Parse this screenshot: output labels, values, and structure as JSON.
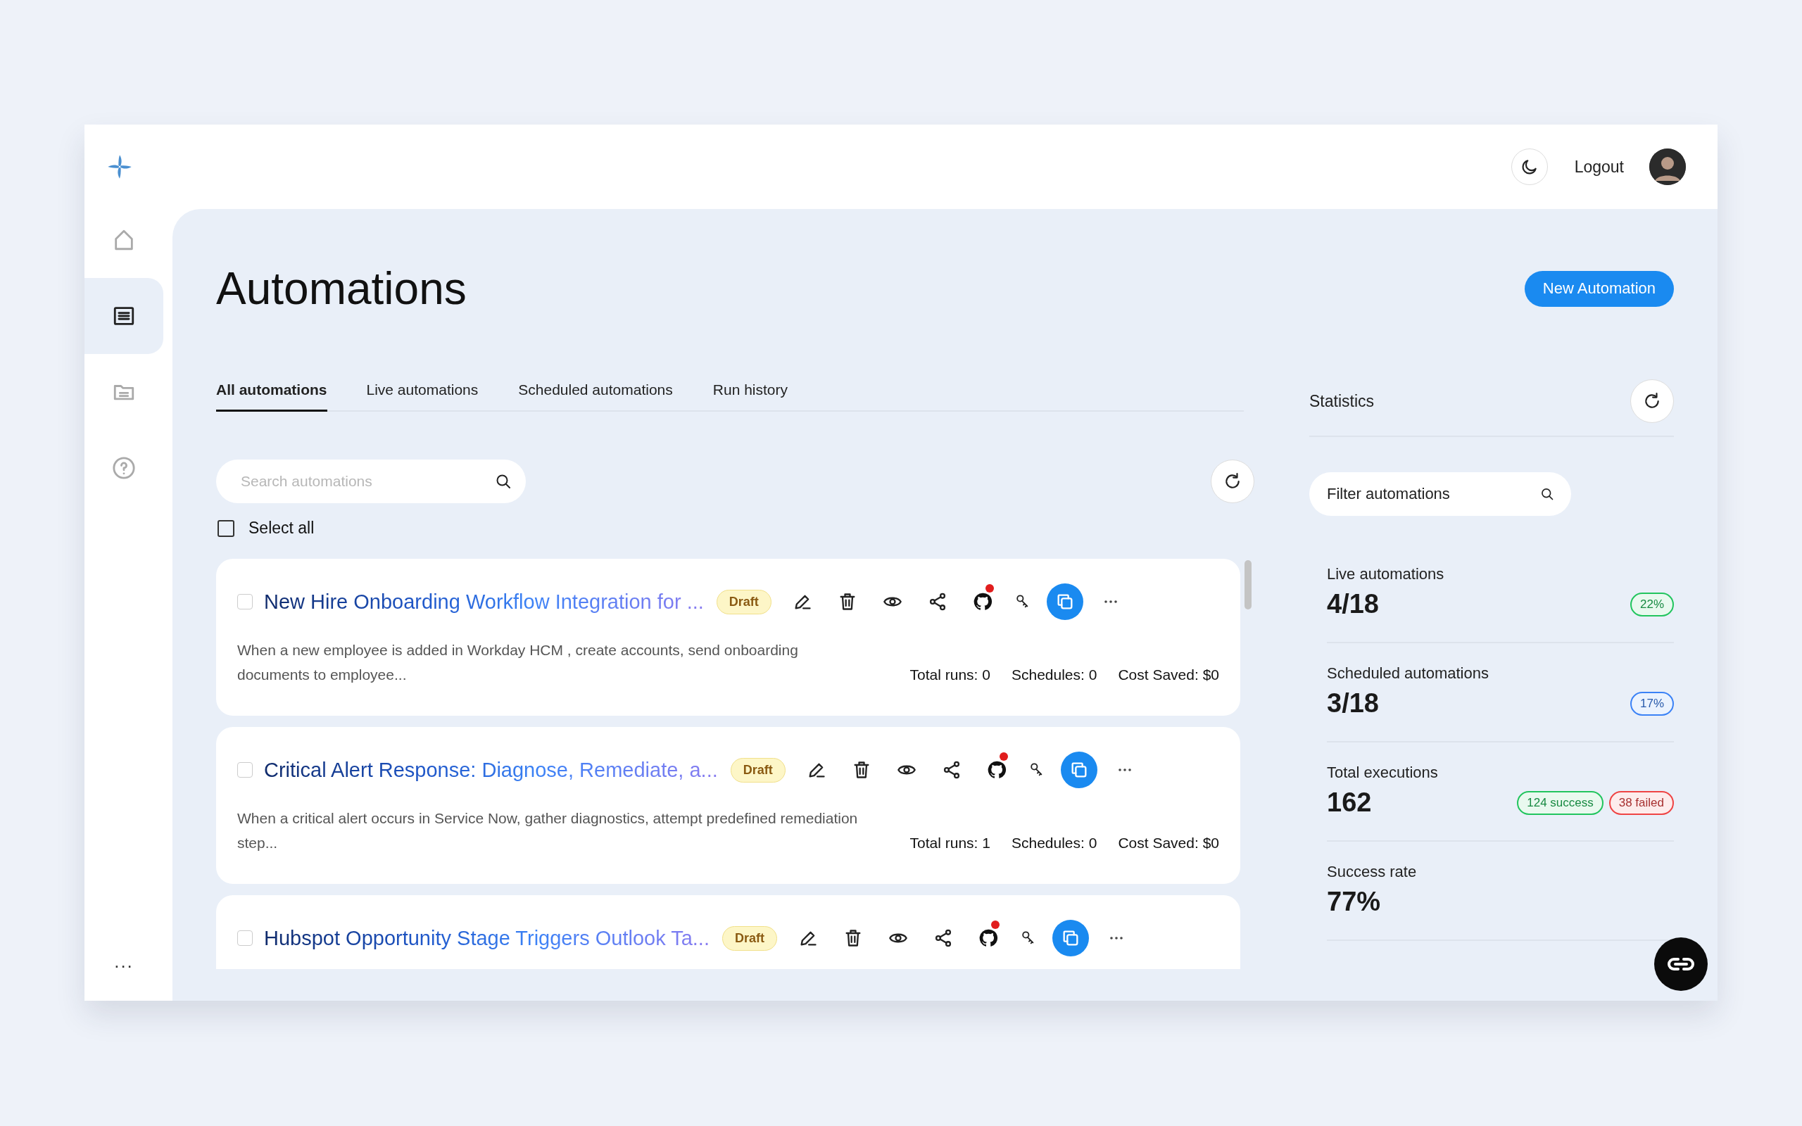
{
  "topbar": {
    "logout": "Logout"
  },
  "sidebar": {
    "items": [
      {
        "kind": "home",
        "selected": false
      },
      {
        "kind": "list",
        "selected": true
      },
      {
        "kind": "folder",
        "selected": false
      },
      {
        "kind": "help",
        "selected": false
      }
    ],
    "more": "..."
  },
  "page": {
    "title": "Automations",
    "new_button": "New Automation"
  },
  "tabs": [
    {
      "label": "All automations",
      "selected": true
    },
    {
      "label": "Live automations",
      "selected": false
    },
    {
      "label": "Scheduled automations",
      "selected": false
    },
    {
      "label": "Run history",
      "selected": false
    }
  ],
  "search": {
    "placeholder": "Search automations"
  },
  "select_all": {
    "label": "Select all",
    "checked": false
  },
  "automations": [
    {
      "title": "New Hire Onboarding Workflow Integration for ...",
      "status": "Draft",
      "checked": false,
      "github_alert": true,
      "description": "When a new employee is added in Workday HCM , create accounts, send onboarding documents to employee...",
      "total_runs": "Total runs: 0",
      "schedules": "Schedules: 0",
      "cost_saved": "Cost Saved: $0"
    },
    {
      "title": "Critical Alert Response: Diagnose, Remediate, a...",
      "status": "Draft",
      "checked": false,
      "github_alert": true,
      "description": "When a critical alert occurs in Service Now, gather diagnostics, attempt predefined remediation step...",
      "total_runs": "Total runs: 1",
      "schedules": "Schedules: 0",
      "cost_saved": "Cost Saved: $0"
    },
    {
      "title": "Hubspot Opportunity Stage Triggers Outlook Ta...",
      "status": "Draft",
      "checked": false,
      "github_alert": true
    }
  ],
  "statistics": {
    "title": "Statistics",
    "filter": {
      "value": "Filter automations"
    },
    "items": [
      {
        "label": "Live automations",
        "value": "4/18",
        "badges": [
          {
            "text": "22%",
            "color": "#22c55e"
          }
        ]
      },
      {
        "label": "Scheduled automations",
        "value": "3/18",
        "badges": [
          {
            "text": "17%",
            "color": "#3b82f6"
          }
        ]
      },
      {
        "label": "Total executions",
        "value": "162",
        "badges": [
          {
            "text": "124 success",
            "color": "#22c55e"
          },
          {
            "text": "38 failed",
            "color": "#ef4444"
          }
        ]
      },
      {
        "label": "Success rate",
        "value": "77%"
      }
    ]
  }
}
